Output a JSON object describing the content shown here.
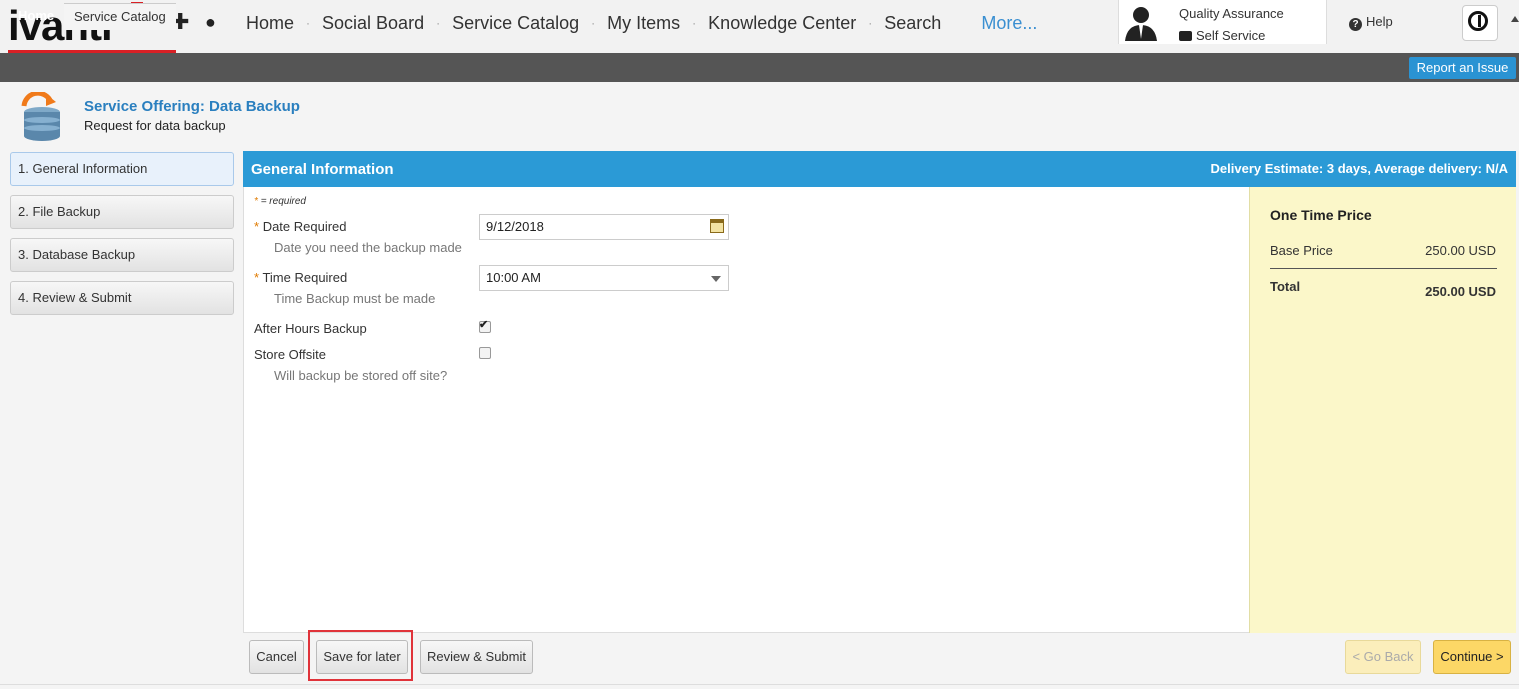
{
  "logo": {
    "text": "ivanti"
  },
  "nav": {
    "items": [
      "Home",
      "Social Board",
      "Service Catalog",
      "My Items",
      "Knowledge Center",
      "Search"
    ],
    "more": "More..."
  },
  "user": {
    "role": "Quality Assurance",
    "context": "Self Service"
  },
  "help": {
    "label": "Help"
  },
  "tabs": {
    "home": "Home",
    "service_catalog": "Service Catalog"
  },
  "report_issue": "Report an Issue",
  "offering": {
    "title": "Service Offering: Data Backup",
    "subtitle": "Request for data backup"
  },
  "steps": [
    "1. General Information",
    "2. File Backup",
    "3. Database Backup",
    "4. Review & Submit"
  ],
  "panel": {
    "title": "General Information",
    "delivery": "Delivery Estimate:  3 days, Average delivery:  N/A"
  },
  "form": {
    "required_note": "= required",
    "date_required": {
      "label": "Date Required",
      "hint": "Date you need the backup made",
      "value": "9/12/2018"
    },
    "time_required": {
      "label": "Time Required",
      "hint": "Time Backup must be made",
      "value": "10:00 AM"
    },
    "after_hours": {
      "label": "After Hours Backup",
      "checked": true
    },
    "store_offsite": {
      "label": "Store Offsite",
      "hint": "Will backup be stored off site?",
      "checked": false
    }
  },
  "price": {
    "title": "One Time Price",
    "base_label": "Base Price",
    "base_value": "250.00 USD",
    "total_label": "Total",
    "total_value": "250.00 USD"
  },
  "buttons": {
    "cancel": "Cancel",
    "save_later": "Save for later",
    "review_submit": "Review & Submit",
    "go_back": "< Go Back",
    "continue": "Continue >"
  },
  "colors": {
    "accent": "#2b9ad6",
    "brand_red": "#d92025",
    "price_bg": "#fbf7c9",
    "primary_btn": "#fcd766"
  }
}
